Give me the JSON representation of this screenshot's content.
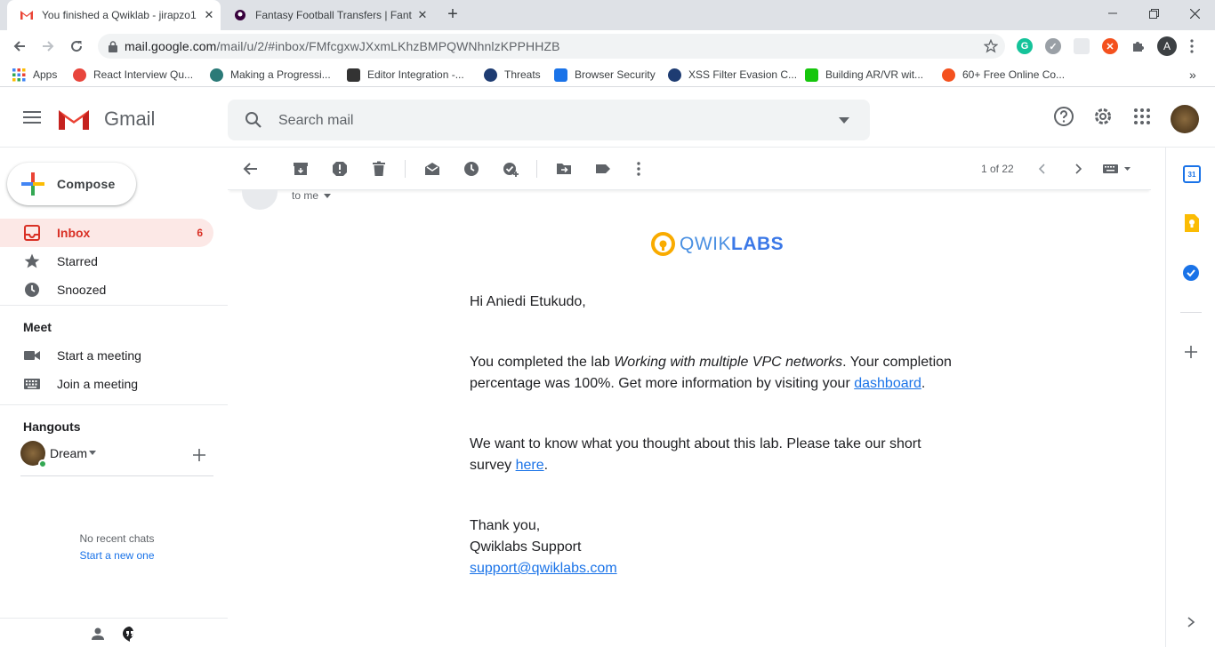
{
  "browser": {
    "tabs": [
      {
        "title": "You finished a Qwiklab - jirapzo1",
        "active": true
      },
      {
        "title": "Fantasy Football Transfers | Fanta",
        "active": false
      }
    ],
    "new_tab": "+",
    "url_host": "mail.google.com",
    "url_path": "/mail/u/2/#inbox/FMfcgxwJXxmLKhzBMPQWNhnlzKPPHHZB",
    "profile_initial": "A",
    "bookmarks": [
      {
        "label": "Apps",
        "icon": "apps-grid-icon",
        "color": "#4285f4"
      },
      {
        "label": "React Interview Qu...",
        "icon": "react-icon",
        "color": "#e8453c"
      },
      {
        "label": "Making a Progressi...",
        "icon": "react-icon",
        "color": "#2b7a78"
      },
      {
        "label": "Editor Integration -...",
        "icon": "editor-icon",
        "color": "#333333"
      },
      {
        "label": "Threats",
        "icon": "shield-icon",
        "color": "#1e3c72"
      },
      {
        "label": "Browser Security",
        "icon": "house-icon",
        "color": "#1a73e8"
      },
      {
        "label": "XSS Filter Evasion C...",
        "icon": "owasp-icon",
        "color": "#1e3c72"
      },
      {
        "label": "Building AR/VR wit...",
        "icon": "power-icon",
        "color": "#16c60c"
      },
      {
        "label": "60+ Free Online Co...",
        "icon": "course-icon",
        "color": "#f4511e"
      }
    ],
    "more_bookmarks": "»"
  },
  "gmail": {
    "logo_text": "Gmail",
    "search_placeholder": "Search mail",
    "compose_label": "Compose",
    "nav": [
      {
        "label": "Inbox",
        "count": "6",
        "selected": true,
        "icon": "inbox-icon"
      },
      {
        "label": "Starred",
        "count": "",
        "selected": false,
        "icon": "star-icon"
      },
      {
        "label": "Snoozed",
        "count": "",
        "selected": false,
        "icon": "clock-icon"
      }
    ],
    "meet": {
      "heading": "Meet",
      "items": [
        {
          "label": "Start a meeting",
          "icon": "video-icon"
        },
        {
          "label": "Join a meeting",
          "icon": "keyboard-icon"
        }
      ]
    },
    "hangouts": {
      "heading": "Hangouts",
      "user": "Dream",
      "no_chats": "No recent chats",
      "start_new": "Start a new one"
    },
    "pager": "1 of 22",
    "email": {
      "to_line": "to me",
      "brand_prefix": "QWIK",
      "brand_suffix": "LABS",
      "greeting": "Hi Aniedi Etukudo,",
      "p1_a": "You completed the lab ",
      "p1_lab": "Working with multiple VPC networks",
      "p1_b": ". Your completion",
      "p1_c": "percentage was 100%. Get more information by visiting your ",
      "p1_link": "dashboard",
      "p1_end": ".",
      "p2_a": "We want to know what you thought about this lab. Please take our short",
      "p2_b": "survey ",
      "p2_link": "here",
      "p2_end": ".",
      "sign1": "Thank you,",
      "sign2": "Qwiklabs Support",
      "sign_email": "support@qwiklabs.com"
    }
  },
  "colors": {
    "accent": "#d93025",
    "link": "#1a73e8",
    "selected_bg": "#fce8e6"
  }
}
